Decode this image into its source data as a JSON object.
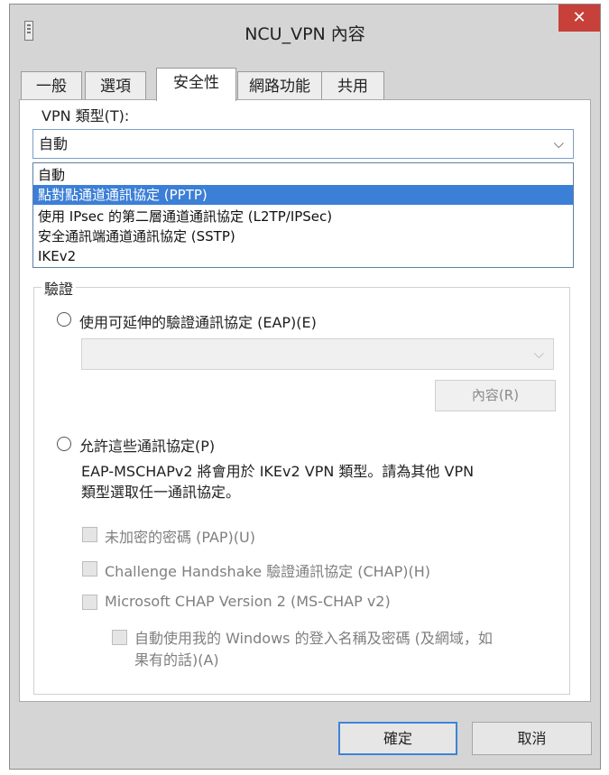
{
  "window": {
    "title": "NCU_VPN 內容",
    "close_glyph": "✕"
  },
  "tabs": [
    {
      "label": "一般"
    },
    {
      "label": "選項"
    },
    {
      "label": "安全性"
    },
    {
      "label": "網路功能"
    },
    {
      "label": "共用"
    }
  ],
  "active_tab": "安全性",
  "vpn_type": {
    "label": "VPN 類型(T):",
    "selected": "自動",
    "options": [
      "自動",
      "點對點通道通訊協定 (PPTP)",
      "使用 IPsec 的第二層通道通訊協定 (L2TP/IPSec)",
      "安全通訊端通道通訊協定 (SSTP)",
      "IKEv2"
    ],
    "highlighted_option": "點對點通道通訊協定 (PPTP)"
  },
  "auth": {
    "group_title": "驗證",
    "eap_radio_label": "使用可延伸的驗證通訊協定 (EAP)(E)",
    "properties_button": "內容(R)",
    "allow_radio_label": "允許這些通訊協定(P)",
    "note_line1": "EAP-MSCHAPv2 將會用於 IKEv2 VPN 類型。請為其他 VPN",
    "note_line2": "類型選取任一通訊協定。",
    "checkboxes": [
      {
        "label": "未加密的密碼 (PAP)(U)",
        "checked": false
      },
      {
        "label": "Challenge Handshake 驗證通訊協定 (CHAP)(H)",
        "checked": false
      },
      {
        "label": "Microsoft CHAP Version 2 (MS-CHAP v2)",
        "checked": false
      }
    ],
    "sub_checkbox_line1": "自動使用我的 Windows 的登入名稱及密碼 (及網域，如",
    "sub_checkbox_line2": "果有的話)(A)"
  },
  "footer": {
    "ok_label": "確定",
    "cancel_label": "取消"
  },
  "icons": {
    "dropdown": "chevron-down-icon",
    "app": "network-connection-icon",
    "close": "close-icon"
  },
  "colors": {
    "close_button": "#c7403a",
    "selection": "#3c7fd6",
    "default_button_border": "#3d83d8"
  }
}
